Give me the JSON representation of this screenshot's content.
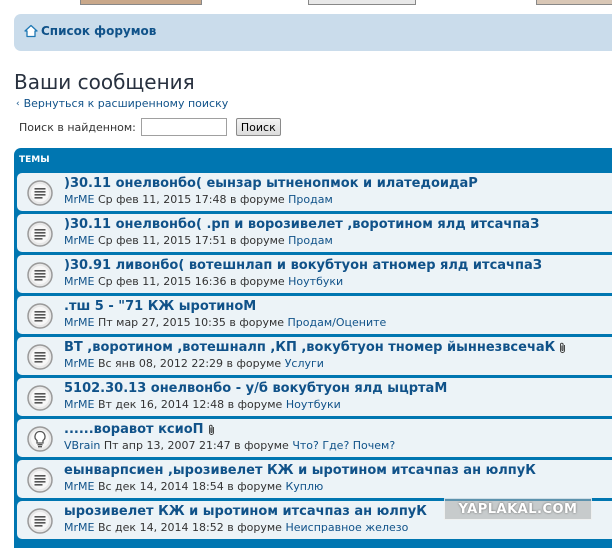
{
  "navbar": {
    "forum_list_label": "Список форумов"
  },
  "page": {
    "title": "Ваши сообщения",
    "back_link": "Вернуться к расширенному поиску"
  },
  "search": {
    "label": "Поиск в найденном:",
    "value": "",
    "button_label": "Поиск"
  },
  "topics_header": "ТЕМЫ",
  "topics": [
    {
      "title": ")30.11 онелвонбо( еынзар ытненопмок и илатедоидаР",
      "user": "MrME",
      "date": "Ср фев 11, 2015 17:48",
      "in_forum": "в форуме",
      "forum": "Продам",
      "icon": "read-topic-icon",
      "attachment": false
    },
    {
      "title": ")30.11 онелвонбо( .рп и ворозивелет ,воротином ялд итсачпаЗ",
      "user": "MrME",
      "date": "Ср фев 11, 2015 17:51",
      "in_forum": "в форуме",
      "forum": "Продам",
      "icon": "read-topic-icon",
      "attachment": false
    },
    {
      "title": ")30.91 ливонбо( вотешнлап и вокубтуон атномер ялд итсачпаЗ",
      "user": "MrME",
      "date": "Ср фев 11, 2015 16:36",
      "in_forum": "в форуме",
      "forum": "Ноутбуки",
      "icon": "read-topic-icon",
      "attachment": false
    },
    {
      "title": ".тш 5 - \"71 КЖ ыротиноМ",
      "user": "MrME",
      "date": "Пт мар 27, 2015 10:35",
      "in_forum": "в форуме",
      "forum": "Продам/Оцените",
      "icon": "read-topic-icon",
      "attachment": false
    },
    {
      "title": "ВТ ,воротином ,вотешналп ,КП ,вокубтуон тномер йыннезвсечаК",
      "user": "MrME",
      "date": "Вс янв 08, 2012 22:29",
      "in_forum": "в форуме",
      "forum": "Услуги",
      "icon": "read-topic-icon",
      "attachment": true
    },
    {
      "title": "5102.30.13 онелвонбо - у/б вокубтуон ялд ыцртаМ",
      "user": "MrME",
      "date": "Вт дек 16, 2014 12:48",
      "in_forum": "в форуме",
      "forum": "Ноутбуки",
      "icon": "read-topic-icon",
      "attachment": false
    },
    {
      "title": "......воравот ксиоП",
      "user": "VBrain",
      "date": "Пт апр 13, 2007 21:47",
      "in_forum": "в форуме",
      "forum": "Что? Где? Почем?",
      "icon": "lightbulb-topic-icon",
      "attachment": true
    },
    {
      "title": "еынварпсиен ,ырозивелет КЖ и ыротином итсачпаз ан юлпуК",
      "user": "MrME",
      "date": "Вс дек 14, 2014 18:54",
      "in_forum": "в форуме",
      "forum": "Куплю",
      "icon": "read-topic-icon",
      "attachment": false
    },
    {
      "title": "ырозивелет КЖ и ыротином итсачпаз ан юлпуК",
      "user": "MrME",
      "date": "Вс дек 14, 2014 18:52",
      "in_forum": "в форуме",
      "forum": "Неисправное железо",
      "icon": "read-topic-icon",
      "attachment": false
    }
  ],
  "watermark": "YAPLAKAL.COM",
  "colors": {
    "header_blue": "#0076b1",
    "row_bg": "#ecf3f7",
    "link": "#105289",
    "navbar_bg": "#cadceb"
  }
}
